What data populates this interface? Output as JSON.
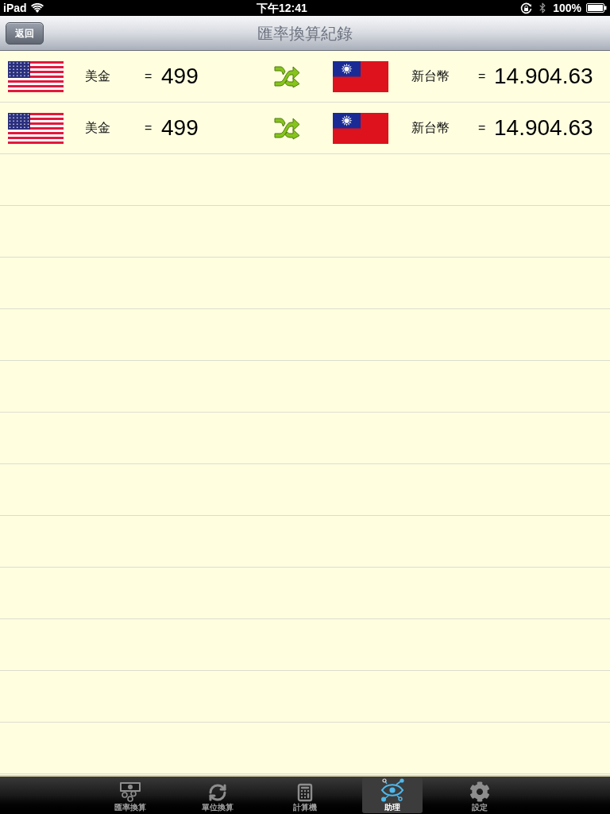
{
  "status_bar": {
    "carrier": "iPad",
    "time": "下午12:41",
    "battery": "100%"
  },
  "nav_bar": {
    "back_button": "返回",
    "title": "匯率換算紀錄"
  },
  "records": [
    {
      "from": {
        "currency": "美金",
        "equals": "=",
        "amount": "499"
      },
      "to": {
        "currency": "新台幣",
        "equals": "=",
        "amount": "14.904.63"
      }
    },
    {
      "from": {
        "currency": "美金",
        "equals": "=",
        "amount": "499"
      },
      "to": {
        "currency": "新台幣",
        "equals": "=",
        "amount": "14.904.63"
      }
    }
  ],
  "tab_bar": [
    {
      "label": "匯率換算",
      "selected": false
    },
    {
      "label": "單位換算",
      "selected": false
    },
    {
      "label": "計算機",
      "selected": false
    },
    {
      "label": "助理",
      "selected": true
    },
    {
      "label": "設定",
      "selected": false
    }
  ]
}
